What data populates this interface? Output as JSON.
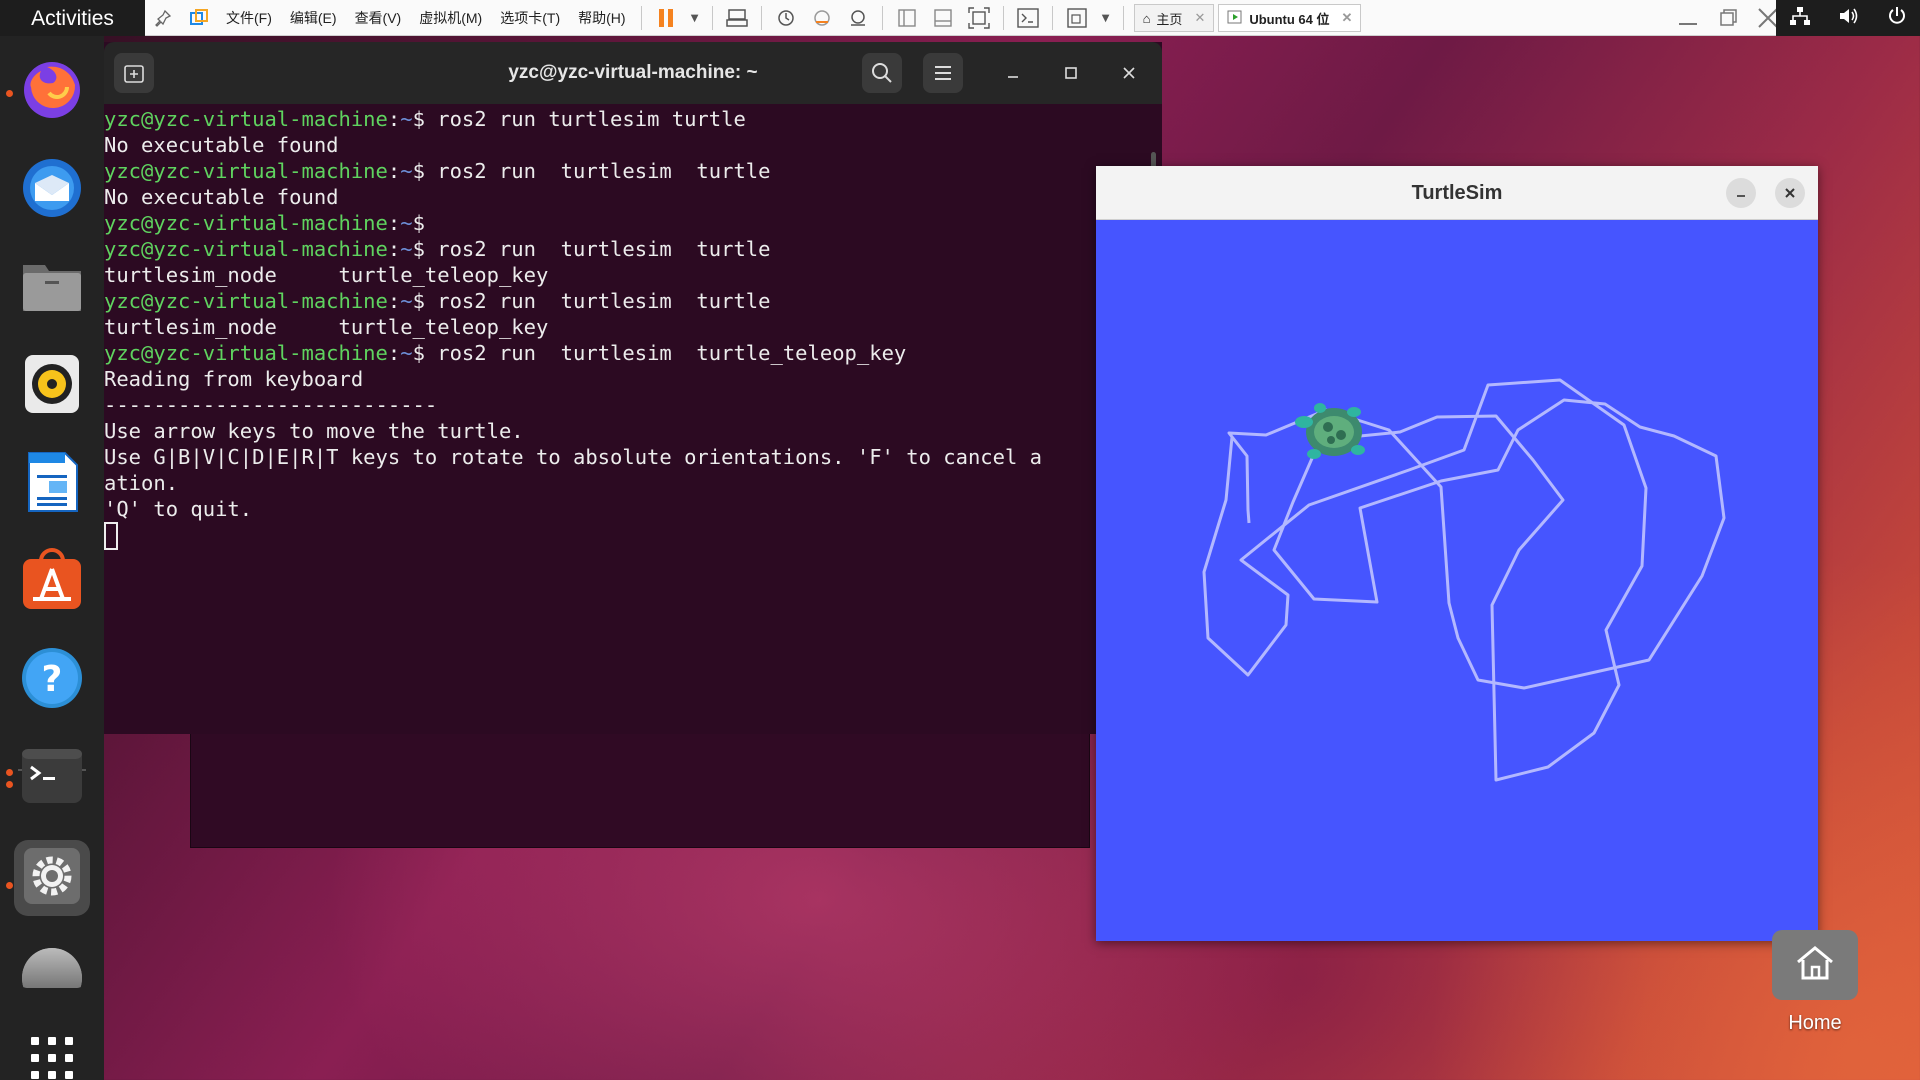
{
  "topbar": {
    "activities": "Activities",
    "menus": [
      "文件(F)",
      "编辑(E)",
      "查看(V)",
      "虚拟机(M)",
      "选项卡(T)",
      "帮助(H)"
    ],
    "tabs": [
      {
        "label": "主页",
        "icon": "home-icon"
      },
      {
        "label": "Ubuntu 64 位",
        "icon": "vm-running-icon"
      }
    ]
  },
  "dock": {
    "apps": [
      {
        "name": "firefox",
        "icon": "firefox-icon",
        "running": true
      },
      {
        "name": "thunderbird",
        "icon": "thunderbird-icon",
        "running": false
      },
      {
        "name": "files",
        "icon": "files-icon",
        "running": false
      },
      {
        "name": "rhythmbox",
        "icon": "rhythmbox-icon",
        "running": false
      },
      {
        "name": "writer",
        "icon": "writer-icon",
        "running": false
      },
      {
        "name": "software",
        "icon": "software-center-icon",
        "running": false
      },
      {
        "name": "help",
        "icon": "help-icon",
        "running": false
      },
      {
        "name": "terminal",
        "icon": "terminal-icon",
        "running": true
      },
      {
        "name": "settings",
        "icon": "settings-icon",
        "running": true
      },
      {
        "name": "show-apps",
        "icon": "app-grid-icon",
        "running": false
      }
    ]
  },
  "terminal": {
    "title": "yzc@yzc-virtual-machine: ~",
    "prompt_user": "yzc@yzc-virtual-machine",
    "prompt_path": "~",
    "lines": [
      {
        "type": "prompt",
        "cmd": "ros2 run turtlesim turtle"
      },
      {
        "type": "out",
        "text": "No executable found"
      },
      {
        "type": "prompt",
        "cmd": "ros2 run  turtlesim  turtle"
      },
      {
        "type": "out",
        "text": "No executable found"
      },
      {
        "type": "prompt",
        "cmd": ""
      },
      {
        "type": "prompt",
        "cmd": "ros2 run  turtlesim  turtle"
      },
      {
        "type": "out",
        "text": "turtlesim_node     turtle_teleop_key"
      },
      {
        "type": "prompt",
        "cmd": "ros2 run  turtlesim  turtle"
      },
      {
        "type": "out",
        "text": "turtlesim_node     turtle_teleop_key"
      },
      {
        "type": "prompt",
        "cmd": "ros2 run  turtlesim  turtle_teleop_key"
      },
      {
        "type": "out",
        "text": "Reading from keyboard"
      },
      {
        "type": "out",
        "text": "---------------------------"
      },
      {
        "type": "out",
        "text": "Use arrow keys to move the turtle."
      },
      {
        "type": "out",
        "text": "Use G|B|V|C|D|E|R|T keys to rotate to absolute orientations. 'F' to cancel a"
      },
      {
        "type": "out",
        "text": "ation."
      },
      {
        "type": "out",
        "text": "'Q' to quit."
      }
    ]
  },
  "turtlesim": {
    "title": "TurtleSim",
    "background": "#4655ff",
    "pen_color": "#b3b8ff"
  },
  "desktop": {
    "home_label": "Home"
  }
}
